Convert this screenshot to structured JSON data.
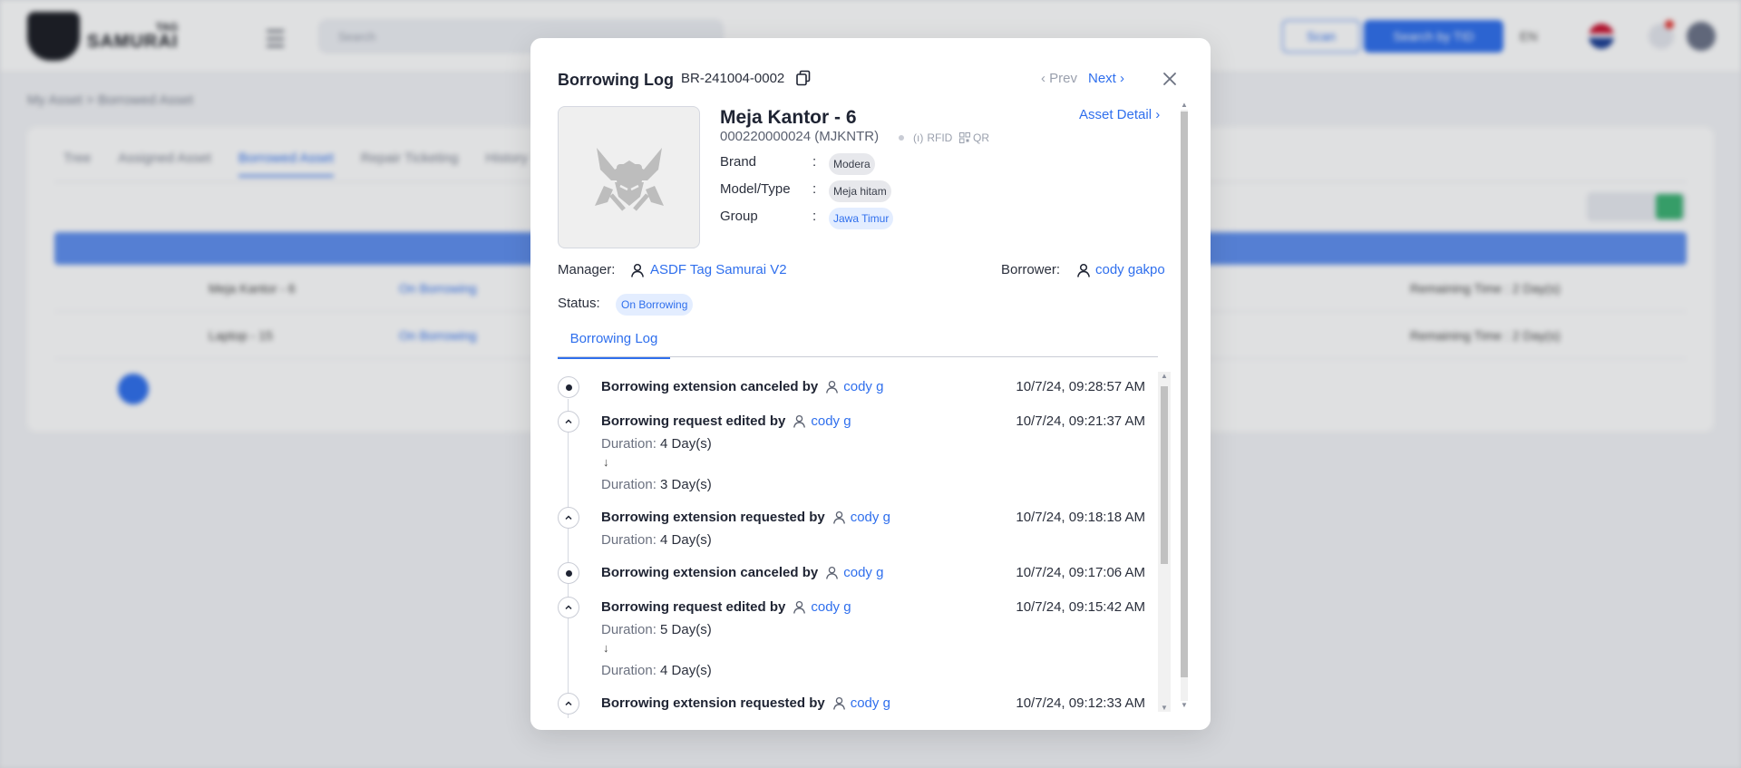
{
  "background": {
    "logo_top": "TAG",
    "logo_bottom": "SAMURAI",
    "search_placeholder": "Search",
    "scan_label": "Scan",
    "search_rfid_label": "Search by TID",
    "lang_label": "EN",
    "breadcrumb": "My Asset  >  Borrowed Asset",
    "tabs": [
      "Tree",
      "Assigned Asset",
      "Borrowed Asset",
      "Repair Ticketing",
      "History"
    ],
    "rows": [
      {
        "name": "Meja Kantor - 6",
        "status": "On Borrowing",
        "note": "Remaining Time : 2 Day(s)"
      },
      {
        "name": "Laptop - 15",
        "status": "On Borrowing",
        "note": "Remaining Time : 2 Day(s)"
      }
    ]
  },
  "modal": {
    "title": "Borrowing Log",
    "code": "BR-241004-0002",
    "prev_label": "‹ Prev",
    "next_label": "Next ›",
    "asset": {
      "name": "Meja Kantor - 6",
      "code": "000220000024 (MJKNTR)",
      "rfid_label": "RFID",
      "qr_label": "QR",
      "detail_link": "Asset Detail ›",
      "brand_label": "Brand",
      "brand_value": "Modera",
      "model_label": "Model/Type",
      "model_value": "Meja hitam",
      "group_label": "Group",
      "group_value": "Jawa Timur",
      "colon": ":"
    },
    "manager_label": "Manager:",
    "manager_value": "ASDF Tag Samurai V2",
    "borrower_label": "Borrower:",
    "borrower_value": "cody gakpo",
    "status_label": "Status:",
    "status_value": "On Borrowing",
    "tab_label": "Borrowing Log",
    "log": [
      {
        "action": "Borrowing extension canceled by",
        "user": "cody g",
        "time": "10/7/24, 09:28:57 AM",
        "icon": "dot"
      },
      {
        "action": "Borrowing request edited by",
        "user": "cody g",
        "time": "10/7/24, 09:21:37 AM",
        "icon": "chevron-up",
        "duration_label": "Duration:",
        "from": "4 Day(s)",
        "to": "3 Day(s)"
      },
      {
        "action": "Borrowing extension requested by",
        "user": "cody g",
        "time": "10/7/24, 09:18:18 AM",
        "icon": "chevron-up",
        "duration_label": "Duration:",
        "value": "4 Day(s)"
      },
      {
        "action": "Borrowing extension canceled by",
        "user": "cody g",
        "time": "10/7/24, 09:17:06 AM",
        "icon": "dot"
      },
      {
        "action": "Borrowing request edited by",
        "user": "cody g",
        "time": "10/7/24, 09:15:42 AM",
        "icon": "chevron-up",
        "duration_label": "Duration:",
        "from": "5 Day(s)",
        "to": "4 Day(s)"
      },
      {
        "action": "Borrowing extension requested by",
        "user": "cody g",
        "time": "10/7/24, 09:12:33 AM",
        "icon": "chevron-up"
      }
    ],
    "arrow_glyph": "↓"
  }
}
